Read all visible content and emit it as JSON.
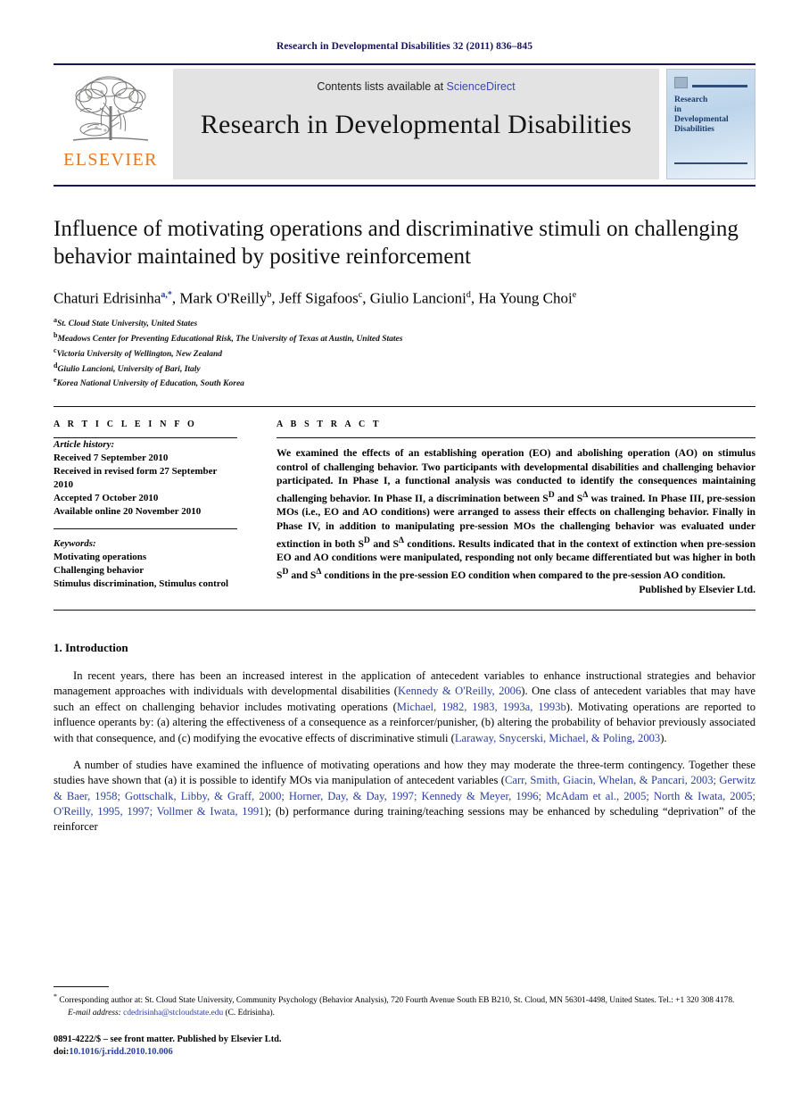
{
  "running_head": "Research in Developmental Disabilities 32 (2011) 836–845",
  "masthead": {
    "contents_text": "Contents lists available at",
    "sciencedirect": "ScienceDirect",
    "journal_title": "Research in Developmental Disabilities",
    "publisher_wordmark": "ELSEVIER",
    "cover_title_lines": [
      "Research",
      "in",
      "Developmental",
      "Disabilities"
    ],
    "accent_blue": "#15145c",
    "elsevier_orange": "#e87722",
    "link_blue": "#2a3f9d"
  },
  "article": {
    "title": "Influence of motivating operations and discriminative stimuli on challenging behavior maintained by positive reinforcement",
    "authors": [
      {
        "name": "Chaturi Edrisinha",
        "marker": "a,*",
        "marker_is_link": true
      },
      {
        "name": "Mark O'Reilly",
        "marker": "b",
        "marker_is_link": false
      },
      {
        "name": "Jeff Sigafoos",
        "marker": "c",
        "marker_is_link": false
      },
      {
        "name": "Giulio Lancioni",
        "marker": "d",
        "marker_is_link": false
      },
      {
        "name": "Ha Young Choi",
        "marker": "e",
        "marker_is_link": false
      }
    ],
    "affiliations": [
      {
        "label": "a",
        "text": "St. Cloud State University, United States"
      },
      {
        "label": "b",
        "text": "Meadows Center for Preventing Educational Risk, The University of Texas at Austin, United States"
      },
      {
        "label": "c",
        "text": "Victoria University of Wellington, New Zealand"
      },
      {
        "label": "d",
        "text": "Giulio Lancioni, University of Bari, Italy"
      },
      {
        "label": "e",
        "text": "Korea National University of Education, South Korea"
      }
    ]
  },
  "article_info": {
    "heading": "A R T I C L E  I N F O",
    "history_label": "Article history:",
    "history": [
      "Received 7 September 2010",
      "Received in revised form 27 September 2010",
      "Accepted 7 October 2010",
      "Available online 20 November 2010"
    ],
    "keywords_label": "Keywords:",
    "keywords": [
      "Motivating operations",
      "Challenging behavior",
      "Stimulus discrimination, Stimulus control"
    ]
  },
  "abstract": {
    "heading": "A B S T R A C T",
    "part1": "We examined the effects of an establishing operation (EO) and abolishing operation (AO) on stimulus control of challenging behavior. Two participants with developmental disabilities and challenging behavior participated. In Phase I, a functional analysis was conducted to identify the consequences maintaining challenging behavior. In Phase II, a discrimination between S",
    "sup1": "D",
    "part2": " and S",
    "sup2": "Δ",
    "part3": " was trained. In Phase III, pre-session MOs (i.e., EO and AO conditions) were arranged to assess their effects on challenging behavior. Finally in Phase IV, in addition to manipulating pre-session MOs the challenging behavior was evaluated under extinction in both S",
    "sup3": "D",
    "part4": " and S",
    "sup4": "Δ",
    "part5": " conditions. Results indicated that in the context of extinction when pre-session EO and AO conditions were manipulated, responding not only became differentiated but was higher in both S",
    "sup5": "D",
    "part6": " and S",
    "sup6": "Δ",
    "part7": " conditions in the pre-session EO condition when compared to the pre-session AO condition.",
    "publisher_line": "Published by Elsevier Ltd."
  },
  "introduction": {
    "heading": "1. Introduction",
    "p1_a": "In recent years, there has been an increased interest in the application of antecedent variables to enhance instructional strategies and behavior management approaches with individuals with developmental disabilities (",
    "p1_cite1": "Kennedy & O'Reilly, 2006",
    "p1_b": "). One class of antecedent variables that may have such an effect on challenging behavior includes motivating operations (",
    "p1_cite2": "Michael, 1982, 1983, 1993a, 1993b",
    "p1_c": "). Motivating operations are reported to influence operants by: (a) altering the effectiveness of a consequence as a reinforcer/punisher, (b) altering the probability of behavior previously associated with that consequence, and (c) modifying the evocative effects of discriminative stimuli (",
    "p1_cite3": "Laraway, Snycerski, Michael, & Poling, 2003",
    "p1_d": ").",
    "p2_a": "A number of studies have examined the influence of motivating operations and how they may moderate the three-term contingency. Together these studies have shown that (a) it is possible to identify MOs via manipulation of antecedent variables (",
    "p2_cite1": "Carr, Smith, Giacin, Whelan, & Pancari, 2003; Gerwitz & Baer, 1958; Gottschalk, Libby, & Graff, 2000; Horner, Day, & Day, 1997; Kennedy & Meyer, 1996; McAdam et al., 2005; North & Iwata, 2005; O'Reilly, 1995, 1997; Vollmer & Iwata, 1991",
    "p2_b": "); (b) performance during training/teaching sessions may be enhanced by scheduling “deprivation” of the reinforcer"
  },
  "footnotes": {
    "corresponding_marker": "*",
    "corresponding": "Corresponding author at: St. Cloud State University, Community Psychology (Behavior Analysis), 720 Fourth Avenue South EB B210, St. Cloud, MN 56301-4498, United States. Tel.: +1 320 308 4178.",
    "email_label": "E-mail address:",
    "email": "cdedrisinha@stcloudstate.edu",
    "email_owner": "(C. Edrisinha)."
  },
  "imprint": {
    "front_matter": "0891-4222/$ – see front matter. Published by Elsevier Ltd.",
    "doi_label": "doi:",
    "doi": "10.1016/j.ridd.2010.10.006"
  }
}
